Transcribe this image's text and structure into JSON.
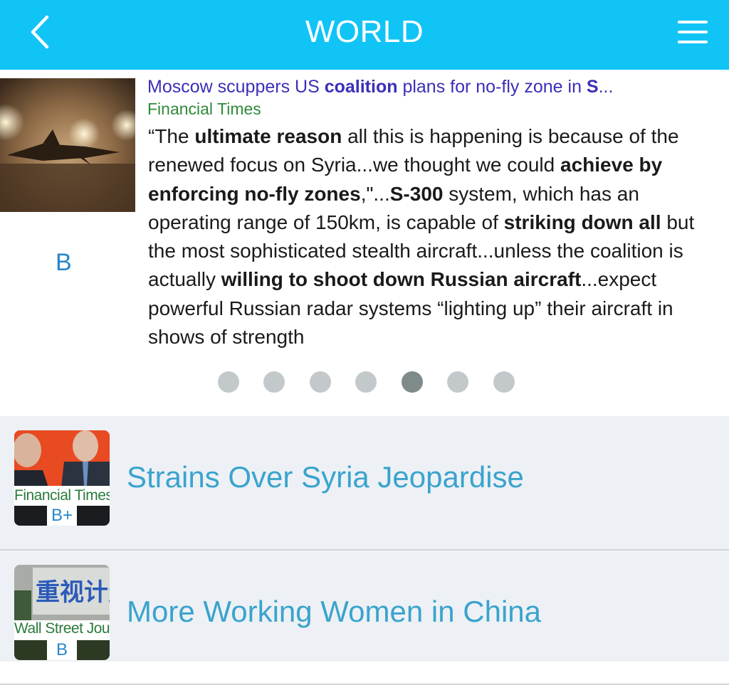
{
  "header": {
    "title": "WORLD",
    "back_icon": "chevron-left-icon",
    "menu_icon": "hamburger-menu-icon",
    "background": "#10c4f6"
  },
  "featured": {
    "headline_parts": [
      "Moscow scuppers US ",
      "coalition",
      " plans for no-fly zone in ",
      "S",
      "..."
    ],
    "source": "Financial Times",
    "grade": "B",
    "quote_parts": [
      "“The ",
      "ultimate reason",
      " all this is happening is because of the renewed focus on Syria...we thought we could ",
      "achieve by enforcing no-fly zones",
      ",\"...",
      "S-300",
      " system, which has an operating range of 150km, is capable of ",
      "striking down all",
      " but the most sophisticated stealth aircraft...unless the coalition is actually ",
      "willing to shoot down Russian aircraft",
      "...expect powerful Russian radar systems “lighting up” their aircraft in shows of strength"
    ]
  },
  "carousel": {
    "count": 7,
    "active_index": 4
  },
  "items": [
    {
      "title": "Strains Over Syria Jeopardise",
      "source": "Financial Times",
      "grade": "B+"
    },
    {
      "title": "More Working Women in China",
      "source": "Wall Street Journal",
      "grade": "B"
    }
  ],
  "colors": {
    "headline": "#3a2fb8",
    "source": "#2f8a3a",
    "item_title": "#3aa3cd",
    "grade": "#2a87c8"
  }
}
